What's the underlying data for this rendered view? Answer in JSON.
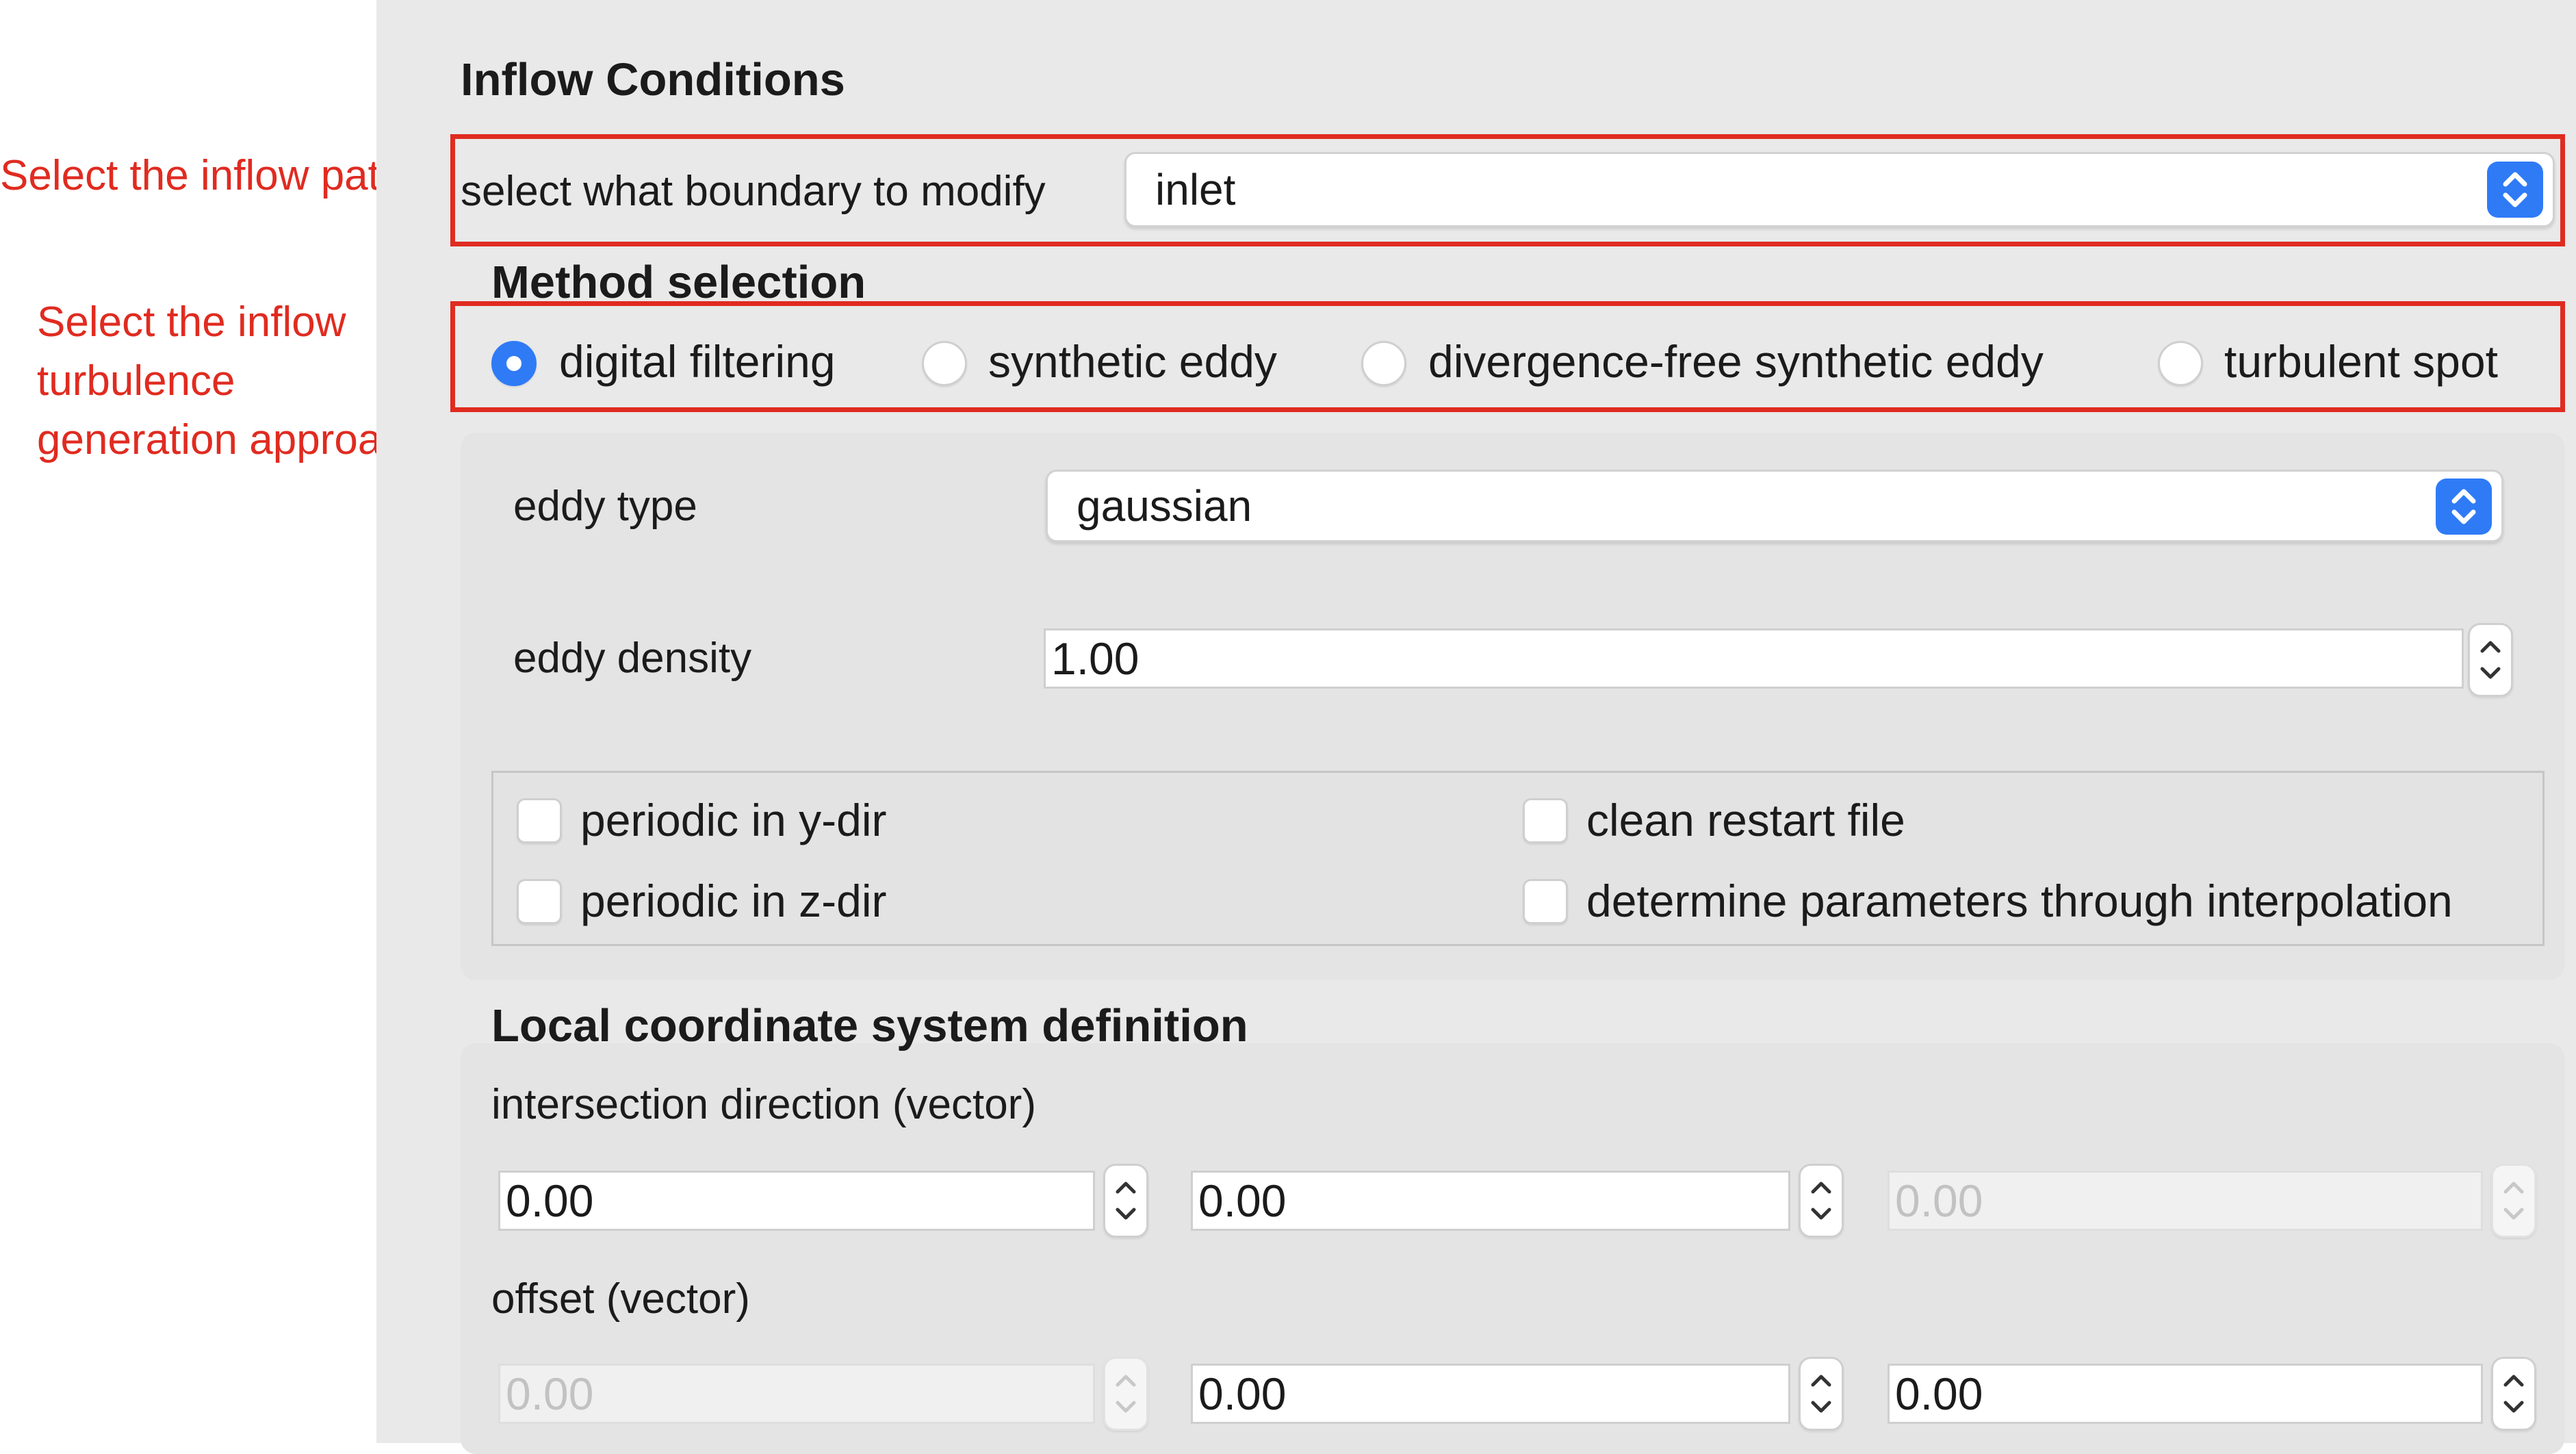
{
  "annotations": {
    "patch": "Select the inflow patch",
    "approach_line1": "Select the inflow",
    "approach_line2": "turbulence",
    "approach_line3": "generation approach"
  },
  "header": {
    "title": "Inflow Conditions"
  },
  "boundary": {
    "label": "select what boundary to modify",
    "value": "inlet"
  },
  "method": {
    "title": "Method selection",
    "options": [
      {
        "label": "digital filtering",
        "selected": true
      },
      {
        "label": "synthetic eddy",
        "selected": false
      },
      {
        "label": "divergence-free synthetic eddy",
        "selected": false
      },
      {
        "label": "turbulent spot",
        "selected": false
      }
    ]
  },
  "eddy": {
    "type_label": "eddy type",
    "type_value": "gaussian",
    "density_label": "eddy density",
    "density_value": "1.00"
  },
  "options": {
    "periodic_y": "periodic in y-dir",
    "periodic_z": "periodic in z-dir",
    "clean_restart": "clean restart file",
    "interp": "determine parameters through interpolation"
  },
  "local_coords": {
    "title": "Local coordinate system definition",
    "intersection_label": "intersection direction (vector)",
    "intersection": [
      "0.00",
      "0.00",
      "0.00"
    ],
    "offset_label": "offset (vector)",
    "offset": [
      "0.00",
      "0.00",
      "0.00"
    ]
  },
  "colors": {
    "accent": "#2f7bf6",
    "annotation": "#e02b20",
    "panel_bg": "#e9e9e9"
  }
}
